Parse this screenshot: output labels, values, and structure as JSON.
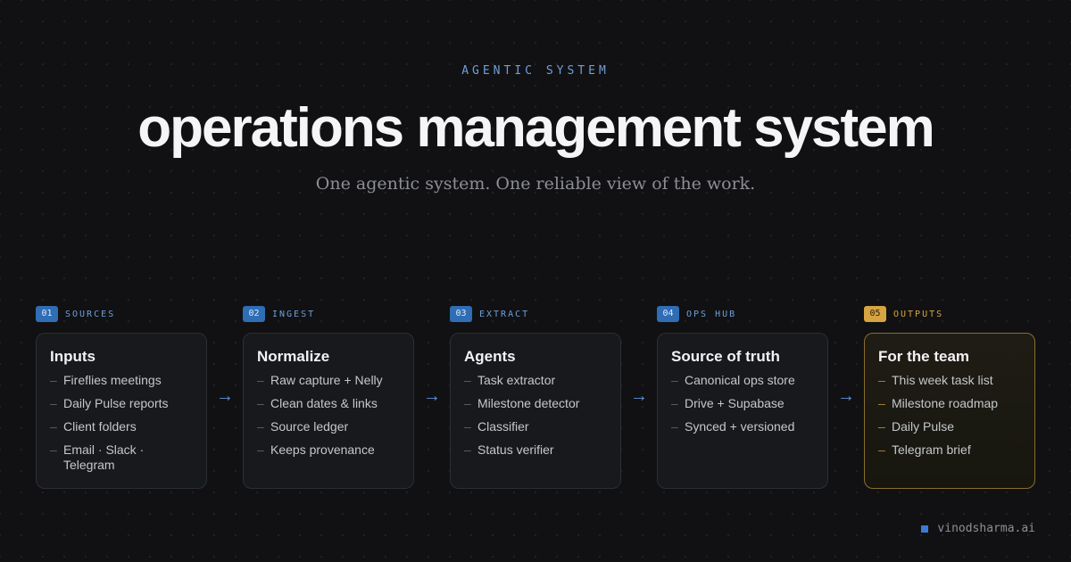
{
  "header": {
    "eyebrow": "AGENTIC SYSTEM",
    "title": "operations management system",
    "subtitle": "One agentic system. One reliable view of the work."
  },
  "colors": {
    "background": "#111113",
    "accent_blue": "#3a7bd5",
    "accent_gold": "#d6a440"
  },
  "arrow_glyph": "→",
  "stages": [
    {
      "num": "01",
      "name": "SOURCES",
      "title": "Inputs",
      "items": [
        "Fireflies meetings",
        "Daily Pulse reports",
        "Client folders",
        "Email · Slack · Telegram"
      ]
    },
    {
      "num": "02",
      "name": "INGEST",
      "title": "Normalize",
      "items": [
        "Raw capture + Nelly",
        "Clean dates & links",
        "Source ledger",
        "Keeps provenance"
      ]
    },
    {
      "num": "03",
      "name": "EXTRACT",
      "title": "Agents",
      "items": [
        "Task extractor",
        "Milestone detector",
        "Classifier",
        "Status verifier"
      ]
    },
    {
      "num": "04",
      "name": "OPS HUB",
      "title": "Source of truth",
      "items": [
        "Canonical ops store",
        "Drive + Supabase",
        "Synced + versioned"
      ]
    },
    {
      "num": "05",
      "name": "OUTPUTS",
      "title": "For the team",
      "items": [
        "This week task list",
        "Milestone roadmap",
        "Daily Pulse",
        "Telegram brief"
      ]
    }
  ],
  "footer": {
    "site": "vinodsharma.ai"
  }
}
